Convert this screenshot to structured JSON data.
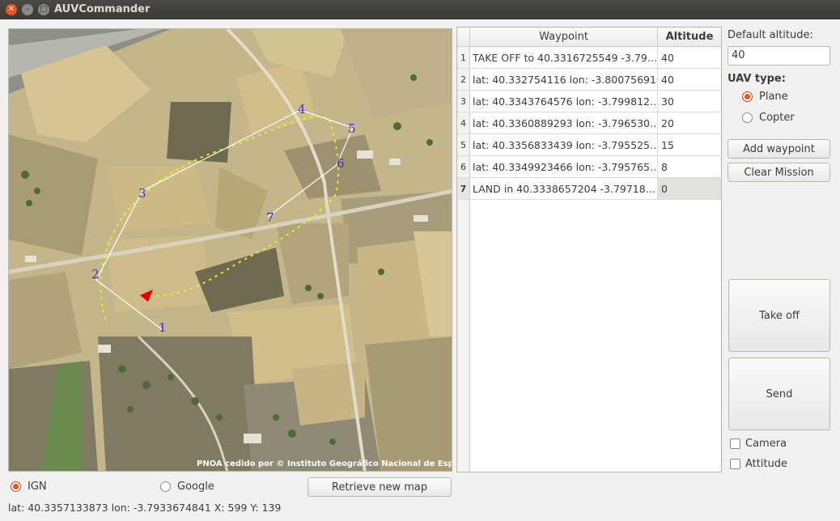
{
  "window": {
    "title": "AUVCommander"
  },
  "map": {
    "attribution": "PNOA cedido por © Instituto Geográfico Nacional de España"
  },
  "table": {
    "headers": {
      "waypoint": "Waypoint",
      "altitude": "Altitude"
    },
    "rows": [
      {
        "n": "1",
        "waypoint": "TAKE OFF to 40.3316725549 -3.79…",
        "altitude": "40"
      },
      {
        "n": "2",
        "waypoint": "lat: 40.332754116 lon: -3.80075691",
        "altitude": "40"
      },
      {
        "n": "3",
        "waypoint": "lat: 40.3343764576 lon: -3.799812…",
        "altitude": "30"
      },
      {
        "n": "4",
        "waypoint": "lat: 40.3360889293 lon: -3.796530…",
        "altitude": "20"
      },
      {
        "n": "5",
        "waypoint": "lat: 40.3356833439 lon: -3.795525…",
        "altitude": "15"
      },
      {
        "n": "6",
        "waypoint": "lat: 40.3349923466 lon: -3.795765…",
        "altitude": "8"
      },
      {
        "n": "7",
        "waypoint": "LAND in 40.3338657204 -3.79718…",
        "altitude": "0"
      }
    ]
  },
  "panel": {
    "default_altitude_label": "Default altitude:",
    "default_altitude_value": "40",
    "uav_type_label": "UAV type:",
    "plane_label": "Plane",
    "copter_label": "Copter",
    "add_waypoint": "Add waypoint",
    "clear_mission": "Clear Mission",
    "take_off": "Take off",
    "send": "Send",
    "camera_label": "Camera",
    "attitude_label": "Attitude"
  },
  "bottom": {
    "ign_label": "IGN",
    "google_label": "Google",
    "retrieve_map": "Retrieve new map",
    "status": "lat: 40.3357133873 lon: -3.7933674841 X: 599 Y: 139"
  },
  "colors": {
    "accent": "#e95420",
    "waypoint_label": "#3a2fd0",
    "route": "#ffffff",
    "track": "#f0f020",
    "uav_marker": "#e00000"
  }
}
